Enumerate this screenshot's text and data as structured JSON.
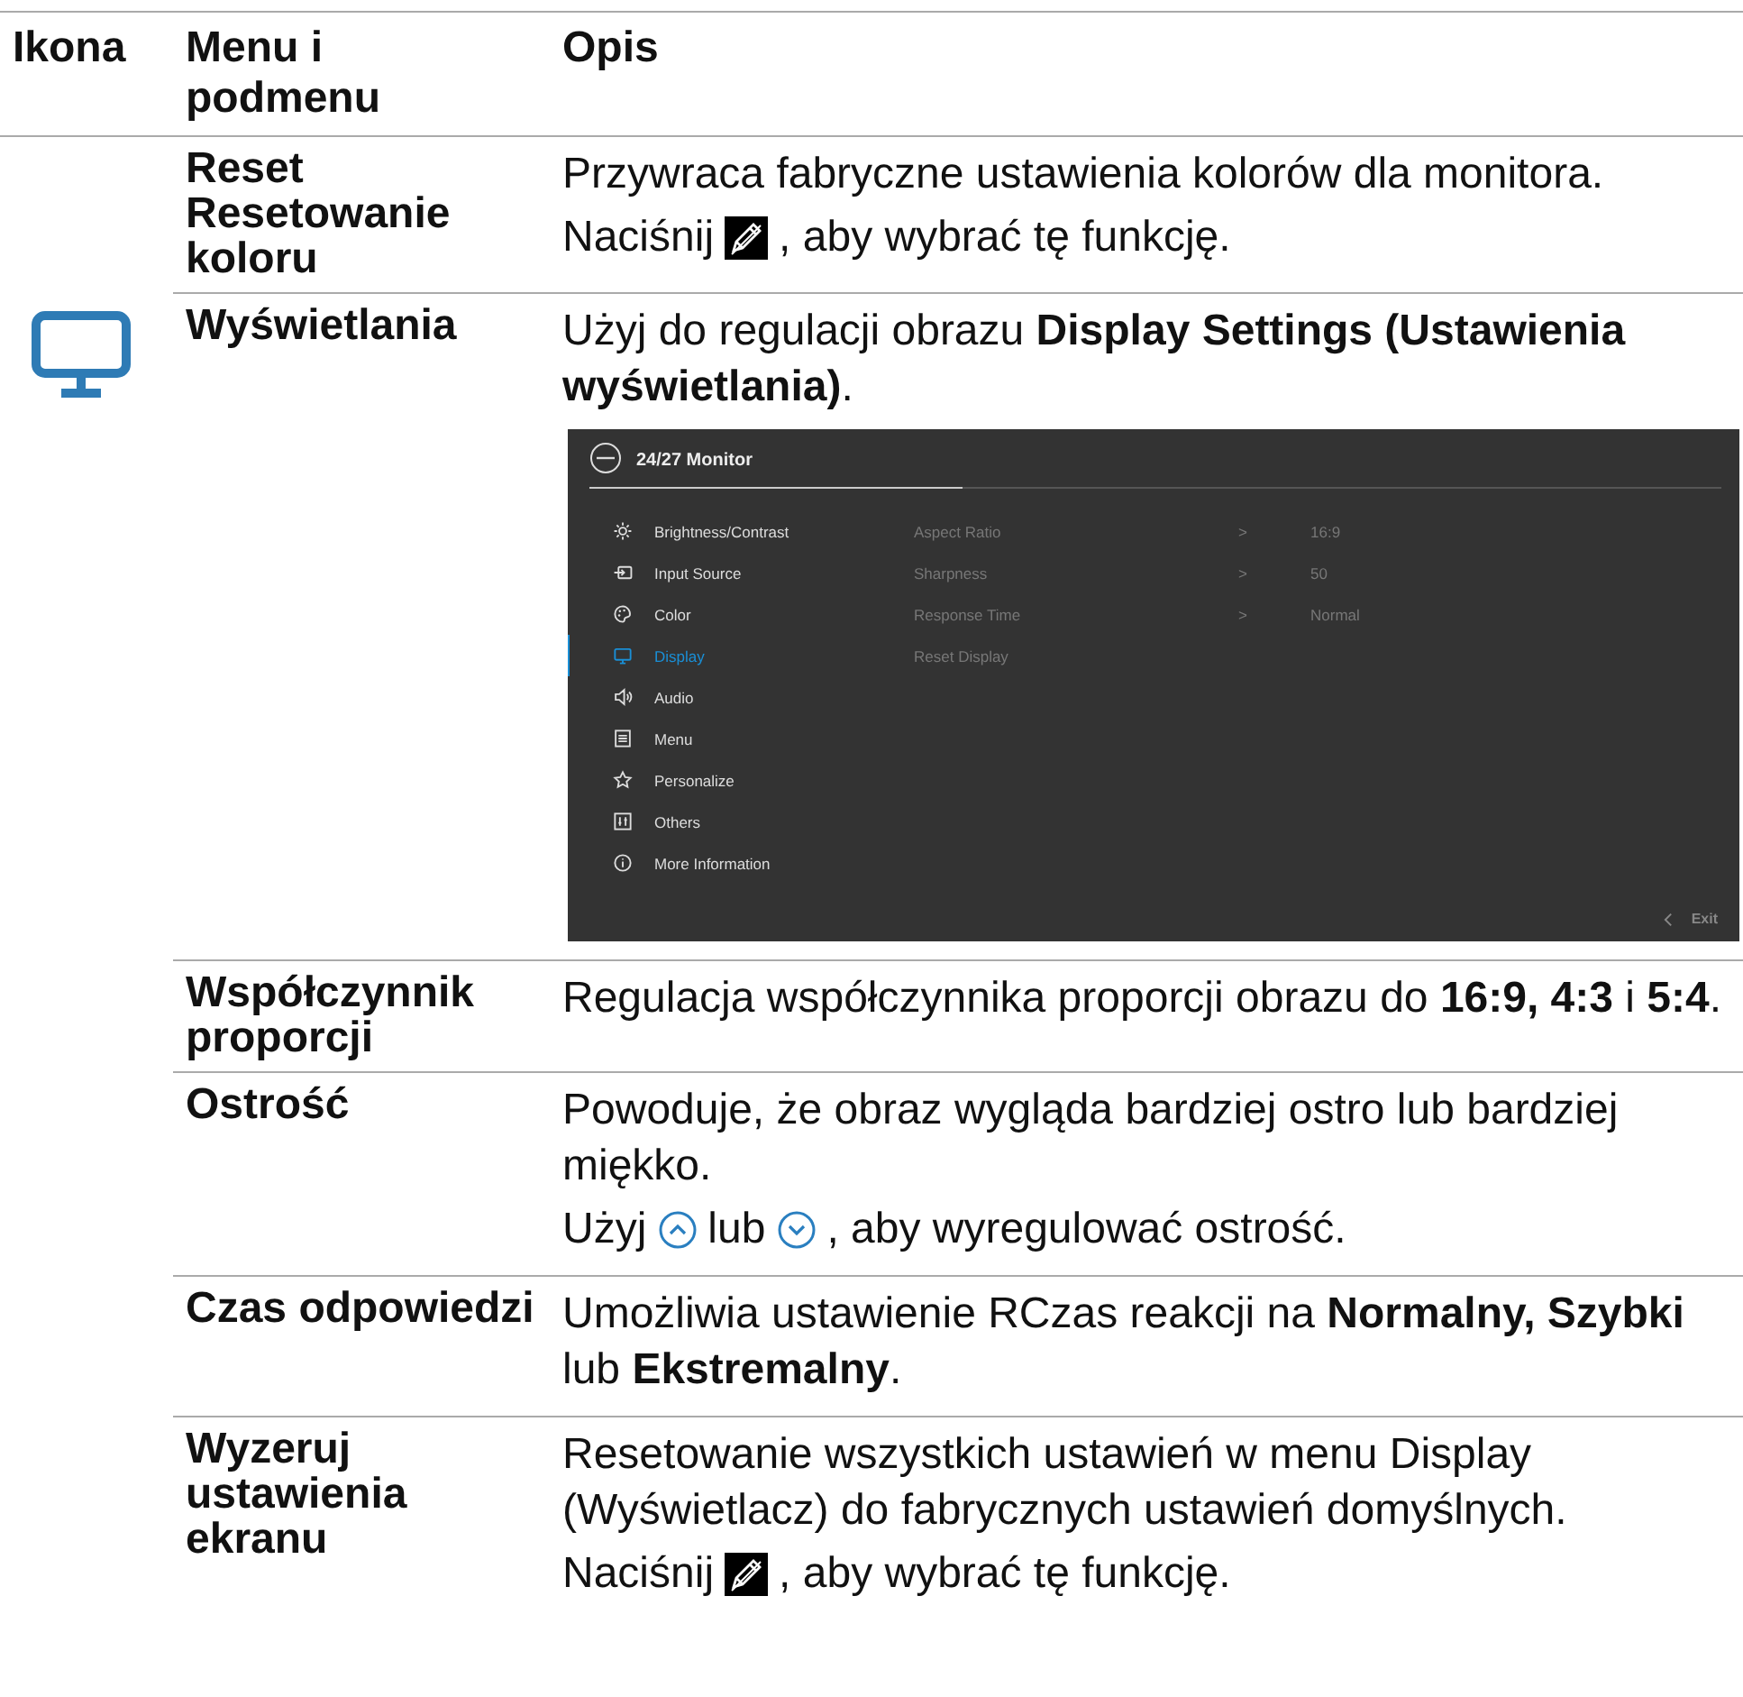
{
  "table": {
    "columns": [
      "Ikona",
      "Menu i podmenu",
      "Opis"
    ],
    "rows": [
      {
        "kind": "plain",
        "label": "Reset Resetowanie koloru",
        "content": [
          {
            "kind": "text",
            "text": "Przywraca fabryczne ustawienia kolorów dla monitora."
          },
          {
            "kind": "parts",
            "parts": [
              {
                "kind": "text",
                "text": "Naciśnij"
              },
              {
                "kind": "pencil"
              },
              {
                "kind": "text",
                "text": ", aby wybrać tę funkcję."
              }
            ]
          }
        ]
      },
      {
        "kind": "monitor",
        "label": "Wyświetlania",
        "content": [
          {
            "kind": "text",
            "text": "Użyj do regulacji obrazu **Display Settings (Ustawienia wyświetlania)**."
          },
          {
            "kind": "osd",
            "osd": {
              "title": "24/27 Monitor",
              "menu": [
                {
                  "kind": "sun",
                  "label": "Brightness/Contrast",
                  "selected": false
                },
                {
                  "kind": "input",
                  "label": "Input Source",
                  "selected": false
                },
                {
                  "kind": "palette",
                  "label": "Color",
                  "selected": false
                },
                {
                  "kind": "monitor",
                  "label": "Display",
                  "selected": true
                },
                {
                  "kind": "speaker",
                  "label": "Audio",
                  "selected": false
                },
                {
                  "kind": "list",
                  "label": "Menu",
                  "selected": false
                },
                {
                  "kind": "star",
                  "label": "Personalize",
                  "selected": false
                },
                {
                  "kind": "sliders",
                  "label": "Others",
                  "selected": false
                },
                {
                  "kind": "info",
                  "label": "More Information",
                  "selected": false
                }
              ],
              "settings": [
                {
                  "label": "Aspect Ratio",
                  "arrow": ">",
                  "value": "16:9"
                },
                {
                  "label": "Sharpness",
                  "arrow": ">",
                  "value": "50"
                },
                {
                  "label": "Response Time",
                  "arrow": ">",
                  "value": "Normal"
                },
                {
                  "label": "Reset Display"
                }
              ],
              "exit": "Exit"
            }
          }
        ]
      },
      {
        "kind": "plain",
        "label": "Współczynnik proporcji",
        "content": [
          {
            "kind": "text",
            "text": "Regulacja współczynnika proporcji obrazu do **16:9, 4:3** i **5:4**."
          }
        ]
      },
      {
        "kind": "plain",
        "label": "Ostrość",
        "content": [
          {
            "kind": "text",
            "text": "Powoduje, że obraz wygląda bardziej ostro lub bardziej miękko."
          },
          {
            "kind": "parts",
            "parts": [
              {
                "kind": "text",
                "text": "Użyj"
              },
              {
                "kind": "chevron-up"
              },
              {
                "kind": "text",
                "text": "lub"
              },
              {
                "kind": "chevron-down"
              },
              {
                "kind": "text",
                "text": ", aby wyregulować ostrość."
              }
            ]
          }
        ]
      },
      {
        "kind": "plain",
        "label": "Czas odpowiedzi",
        "content": [
          {
            "kind": "text",
            "text": "Umożliwia ustawienie RCzas reakcji na **Normalny, Szybki** lub **Ekstremalny**."
          }
        ]
      },
      {
        "kind": "plain",
        "label": "Wyzeruj ustawienia ekranu",
        "content": [
          {
            "kind": "text",
            "text": "Resetowanie wszystkich ustawień w menu Display (Wyświetlacz) do fabrycznych ustawień domyślnych."
          },
          {
            "kind": "parts",
            "parts": [
              {
                "kind": "text",
                "text": "Naciśnij"
              },
              {
                "kind": "pencil"
              },
              {
                "kind": "text",
                "text": ", aby wybrać tę funkcję."
              }
            ]
          }
        ]
      }
    ]
  }
}
